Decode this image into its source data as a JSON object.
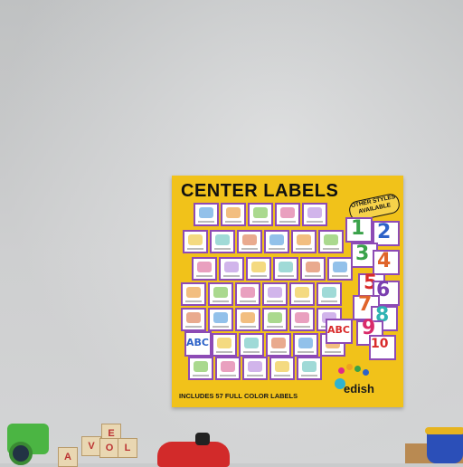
{
  "poster": {
    "title": "CENTER LABELS",
    "banner": "OTHER STYLES AVAILABLE",
    "footer": "INCLUDES 57 FULL COLOR LABELS",
    "logo": "edish",
    "numbers": [
      "1",
      "2",
      "3",
      "4",
      "5",
      "6",
      "7",
      "8",
      "9",
      "10"
    ],
    "abc_tiles": [
      "ABC",
      "ABC"
    ],
    "colors": {
      "background": "#f1c21a",
      "card_border": "#8d4bb5"
    }
  },
  "toys": {
    "block_letters": [
      "E",
      "V",
      "O",
      "L",
      "A"
    ]
  }
}
